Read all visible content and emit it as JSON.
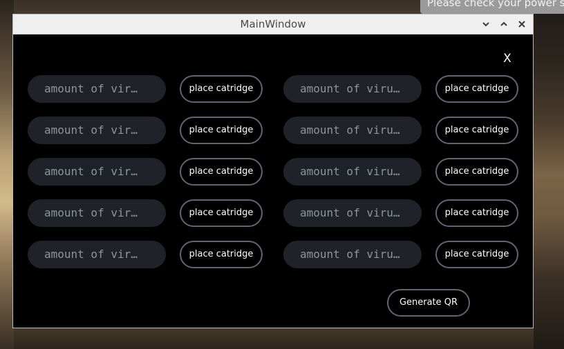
{
  "notification": {
    "text": "Please check your power s"
  },
  "window": {
    "title": "MainWindow",
    "close_label": "X",
    "controls": {
      "minimize": "⌄",
      "maximize": "⌃",
      "close": "✕"
    }
  },
  "rows": [
    {
      "left_field": "amount of vir…",
      "left_button": "place catridge",
      "right_field": "amount of viru…",
      "right_button": "place catridge"
    },
    {
      "left_field": "amount of vir…",
      "left_button": "place catridge",
      "right_field": "amount of viru…",
      "right_button": "place catridge"
    },
    {
      "left_field": "amount of vir…",
      "left_button": "place catridge",
      "right_field": "amount of viru…",
      "right_button": "place catridge"
    },
    {
      "left_field": "amount of vir…",
      "left_button": "place catridge",
      "right_field": "amount of viru…",
      "right_button": "place catridge"
    },
    {
      "left_field": "amount of vir…",
      "left_button": "place catridge",
      "right_field": "amount of viru…",
      "right_button": "place catridge"
    }
  ],
  "generate_label": "Generate QR"
}
